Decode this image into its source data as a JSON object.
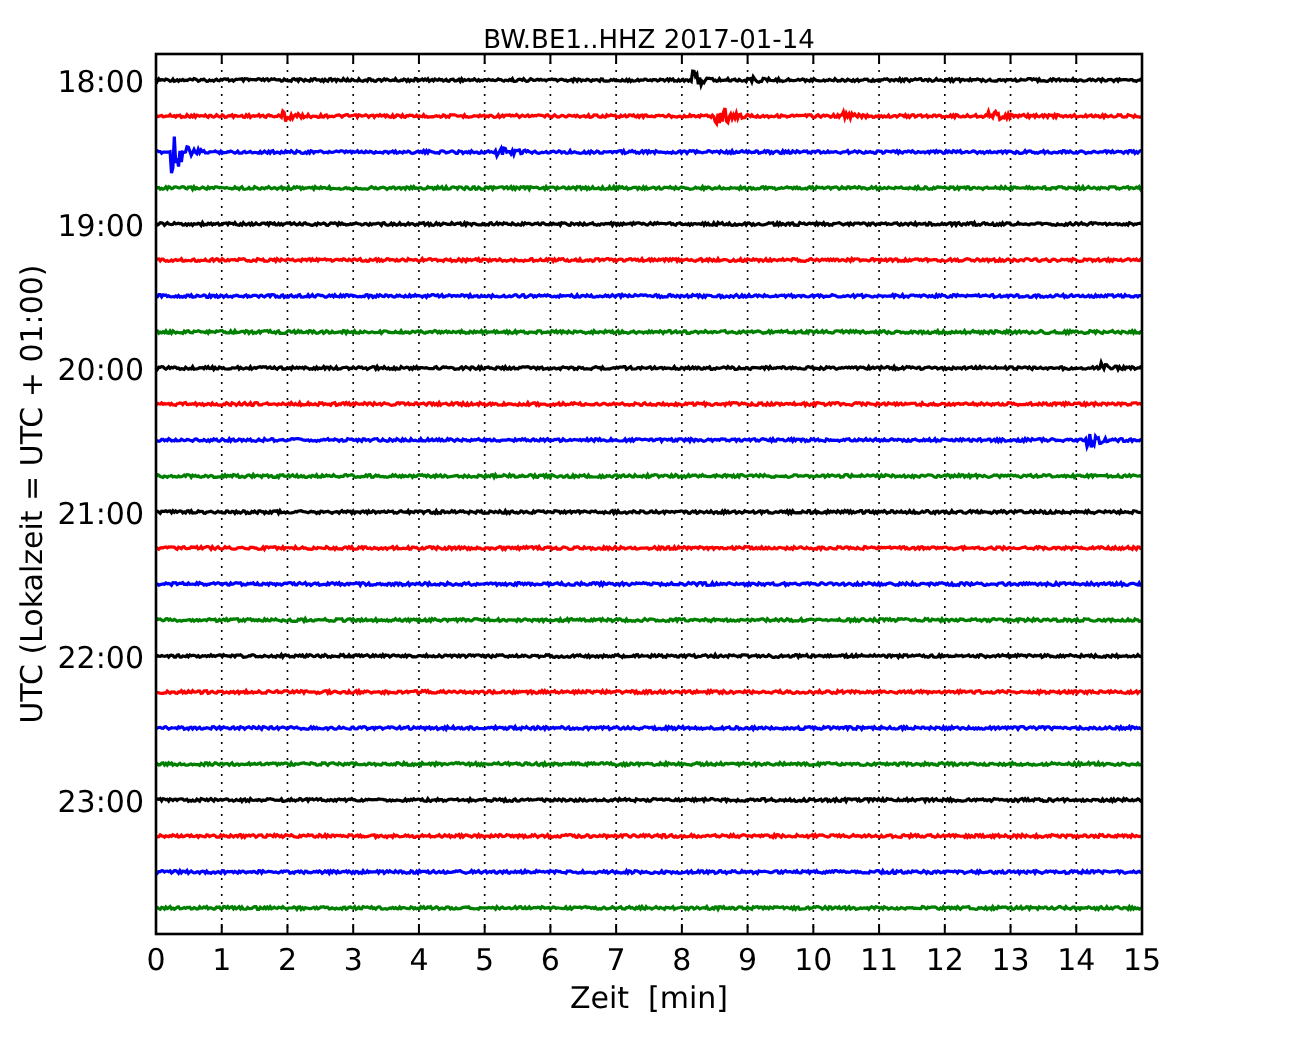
{
  "title": "BW.BE1..HHZ 2017-01-14",
  "ylabel": "UTC (Lokalzeit = UTC + 01:00)",
  "xlabel": "Zeit  [min]",
  "xticks": [
    "0",
    "1",
    "2",
    "3",
    "4",
    "5",
    "6",
    "7",
    "8",
    "9",
    "10",
    "11",
    "12",
    "13",
    "14",
    "15"
  ],
  "yticks": [
    "18:00",
    "19:00",
    "20:00",
    "21:00",
    "22:00",
    "23:00"
  ],
  "traces": [
    {
      "color": "#000000"
    },
    {
      "color": "#ff0000"
    },
    {
      "color": "#0000ff"
    },
    {
      "color": "#008000"
    },
    {
      "color": "#000000"
    },
    {
      "color": "#ff0000"
    },
    {
      "color": "#0000ff"
    },
    {
      "color": "#008000"
    },
    {
      "color": "#000000"
    },
    {
      "color": "#ff0000"
    },
    {
      "color": "#0000ff"
    },
    {
      "color": "#008000"
    },
    {
      "color": "#000000"
    },
    {
      "color": "#ff0000"
    },
    {
      "color": "#0000ff"
    },
    {
      "color": "#008000"
    },
    {
      "color": "#000000"
    },
    {
      "color": "#ff0000"
    },
    {
      "color": "#0000ff"
    },
    {
      "color": "#008000"
    },
    {
      "color": "#000000"
    },
    {
      "color": "#ff0000"
    },
    {
      "color": "#0000ff"
    },
    {
      "color": "#008000"
    }
  ]
}
